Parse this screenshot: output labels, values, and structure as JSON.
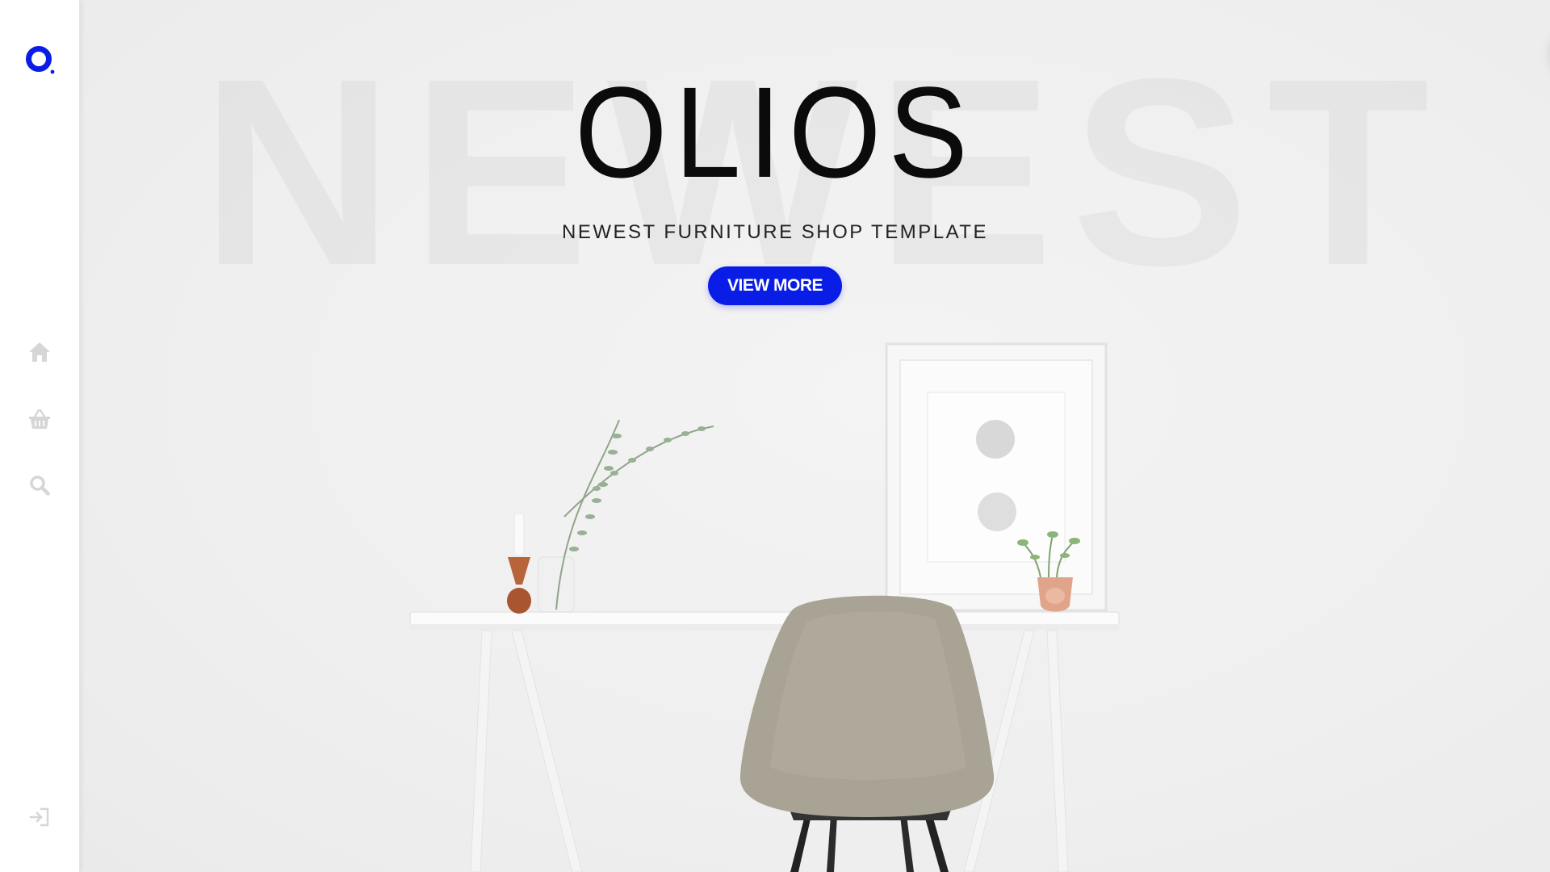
{
  "brand": {
    "logo_icon": "olios-logo-icon",
    "accent_color": "#0a1de6"
  },
  "sidebar": {
    "items": [
      {
        "icon": "home-icon"
      },
      {
        "icon": "basket-icon"
      },
      {
        "icon": "search-icon"
      }
    ],
    "footer_icon": "sign-in-icon"
  },
  "hero": {
    "background_word": "NEWEST",
    "title": "OLIOS",
    "subtitle": "NEWEST FURNITURE SHOP TEMPLATE",
    "cta_label": "VIEW MORE"
  },
  "menu_button": {
    "icon": "hamburger-menu-icon"
  }
}
